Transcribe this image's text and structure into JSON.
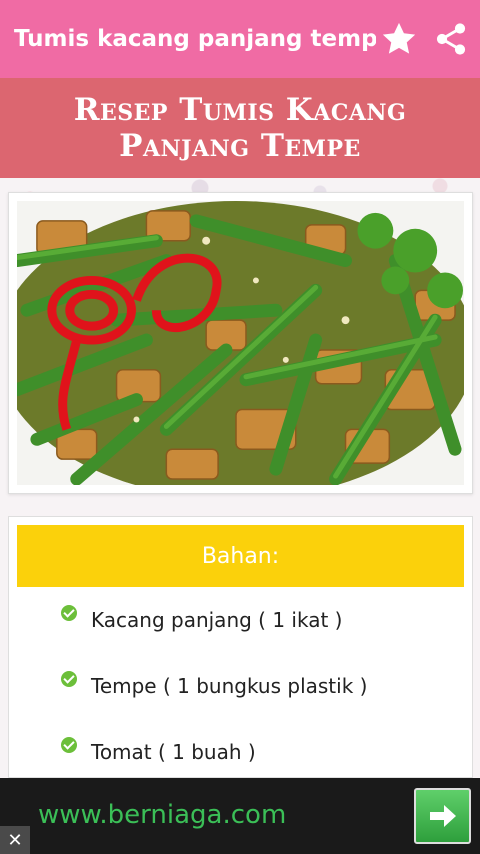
{
  "appbar": {
    "title": "Tumis kacang panjang tempe",
    "favorite_icon": "star-icon",
    "share_icon": "share-icon"
  },
  "header": {
    "title": "Resep Tumis Kacang Panjang Tempe"
  },
  "recipe_image": {
    "alt": "Tumis kacang panjang tempe dish"
  },
  "ingredients": {
    "heading": "Bahan:",
    "items": [
      "Kacang panjang ( 1 ikat )",
      "Tempe ( 1 bungkus plastik )",
      "Tomat ( 1 buah )"
    ]
  },
  "ad": {
    "text": "www.berniaga.com",
    "close_label": "✕",
    "arrow_icon": "arrow-right-icon"
  },
  "colors": {
    "appbar": "#f06ba4",
    "header_band": "#dc6670",
    "ingredients_header": "#fbd10b",
    "check": "#6cbf3a",
    "ad_text": "#3bbf57"
  }
}
